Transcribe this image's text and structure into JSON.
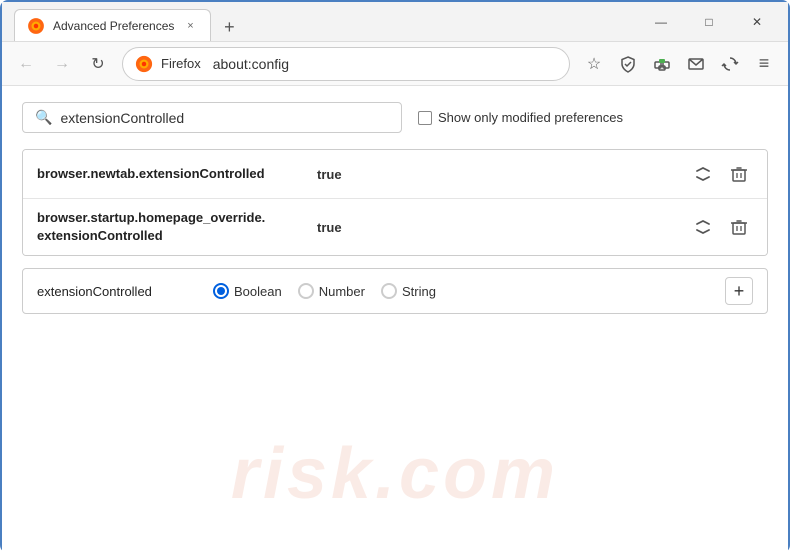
{
  "window": {
    "title": "Advanced Preferences",
    "tab_close": "×",
    "new_tab": "+",
    "minimize": "—",
    "maximize": "□",
    "close": "✕"
  },
  "toolbar": {
    "back_label": "←",
    "forward_label": "→",
    "reload_label": "↻",
    "firefox_label": "Firefox",
    "address": "about:config",
    "bookmark_icon": "☆",
    "shield_icon": "🛡",
    "extension_icon": "🧩",
    "email_icon": "✉",
    "synced_icon": "↻",
    "menu_icon": "≡"
  },
  "search": {
    "placeholder": "",
    "value": "extensionControlled",
    "show_modified_label": "Show only modified preferences"
  },
  "results": [
    {
      "name": "browser.newtab.extensionControlled",
      "value": "true"
    },
    {
      "name": "browser.startup.homepage_override.\nextensionControlled",
      "name_line1": "browser.startup.homepage_override.",
      "name_line2": "extensionControlled",
      "value": "true"
    }
  ],
  "add_pref": {
    "name": "extensionControlled",
    "types": [
      {
        "label": "Boolean",
        "selected": true
      },
      {
        "label": "Number",
        "selected": false
      },
      {
        "label": "String",
        "selected": false
      }
    ],
    "add_btn": "+"
  },
  "watermark": "risk.com"
}
